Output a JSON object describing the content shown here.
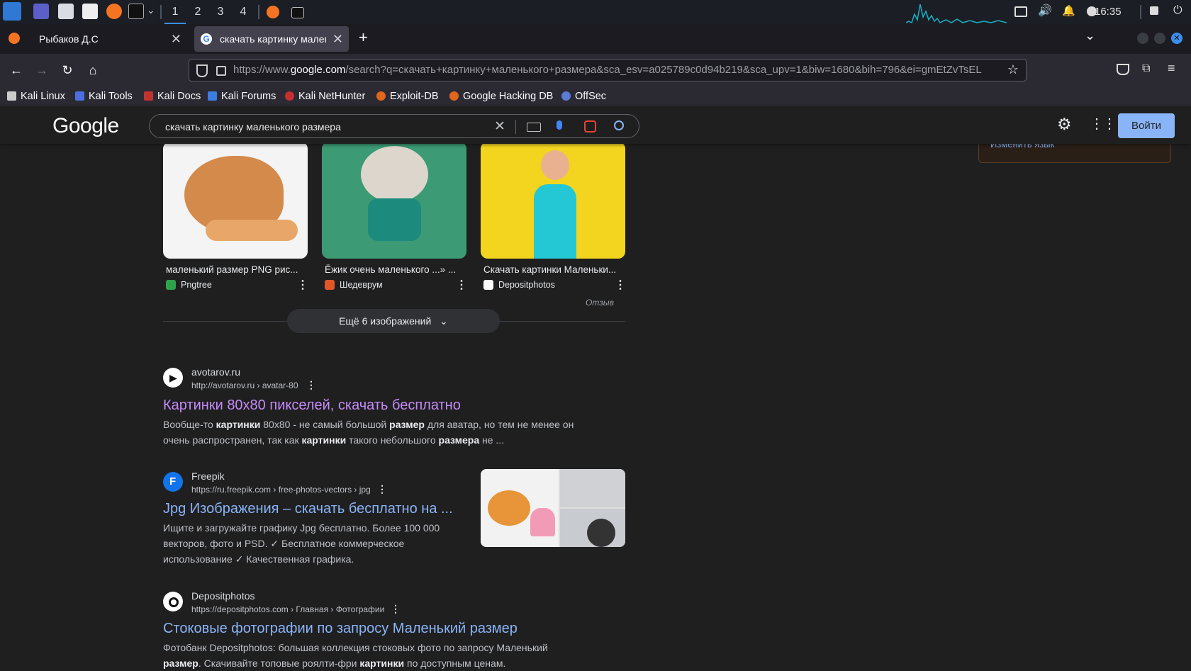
{
  "taskbar": {
    "workspaces": [
      "1",
      "2",
      "3",
      "4"
    ],
    "clock": "16:35"
  },
  "tabs": [
    {
      "label": "Рыбаков Д.С"
    },
    {
      "label": "скачать картинку маленького размера"
    }
  ],
  "navbar": {
    "url_prefix": "https://www.",
    "url_domain": "google.com",
    "url_rest": "/search?q=скачать+картинку+маленького+размера&sca_esv=a025789c0d94b219&sca_upv=1&biw=1680&bih=796&ei=gmEtZvTsEL"
  },
  "bookmarks": [
    "Kali Linux",
    "Kali Tools",
    "Kali Docs",
    "Kali Forums",
    "Kali NetHunter",
    "Exploit-DB",
    "Google Hacking DB",
    "OffSec"
  ],
  "google": {
    "logo": "Google",
    "query": "скачать картинку маленького размера",
    "signin": "Войти",
    "side_link": "Изменить язык"
  },
  "images": [
    {
      "caption": "маленький размер PNG рис...",
      "source": "Pngtree"
    },
    {
      "caption": "Ёжик очень маленького ...» ...",
      "source": "Шедеврум"
    },
    {
      "caption": "Скачать картинки Маленьки...",
      "source": "Depositphotos"
    }
  ],
  "feedback": "Отзыв",
  "more_images": "Ещё 6 изображений",
  "results": [
    {
      "site": "avotarov.ru",
      "url": "http://avotarov.ru › avatar-80",
      "title": "Картинки 80х80 пикселей, скачать бесплатно",
      "snippet": [
        "Вообще-то ",
        "картинки",
        " 80x80 - не самый большой ",
        "размер",
        " для аватар, но тем не менее он очень распространен, так как ",
        "картинки",
        " такого небольшого ",
        "размера",
        " не ..."
      ]
    },
    {
      "site": "Freepik",
      "url": "https://ru.freepik.com › free-photos-vectors › jpg",
      "title": "Jpg Изображения – скачать бесплатно на ...",
      "snippet": [
        "Ищите и загружайте графику Jpg бесплатно. Более 100 000 векторов, фото и PSD. ✓ Бесплатное коммерческое использование ✓ Качественная графика."
      ]
    },
    {
      "site": "Depositphotos",
      "url": "https://depositphotos.com › Главная › Фотографии",
      "title": "Стоковые фотографии по запросу Маленький размер",
      "snippet": [
        "Фотобанк Depositphotos: большая коллекция стоковых фото по запросу Маленький ",
        "размер",
        ". Скачивайте топовые роялти-фри ",
        "картинки",
        " по доступным ценам."
      ]
    }
  ],
  "colors": {
    "visited_link": "#c58af9",
    "link": "#8ab4f8",
    "background": "#1f1f1f"
  }
}
